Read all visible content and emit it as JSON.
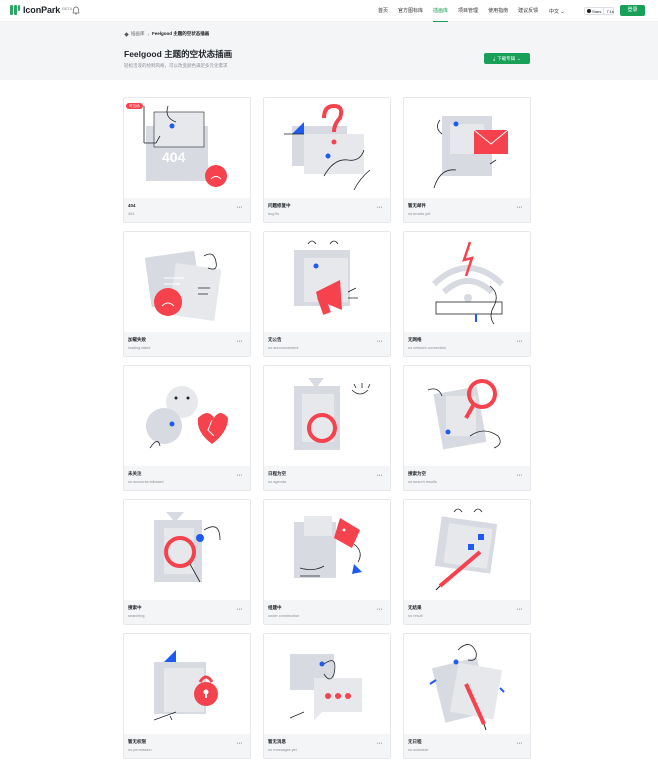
{
  "nav": {
    "logo_text": "IconPark",
    "logo_beta": "BETA",
    "menu": [
      "首页",
      "官方图标库",
      "插画库",
      "项目管理",
      "使用指南",
      "建议反馈"
    ],
    "active_index": 2,
    "lang": "中文",
    "github_label": "Stars",
    "github_count": "7.1k",
    "login": "登录",
    "accent": "#18a058"
  },
  "hero": {
    "breadcrumb_home": "插画库",
    "breadcrumb_current": "Feelgood 主题的空状态插画",
    "title": "Feelgood 主题的空状态插画",
    "subtitle": "轻松活泼的绘制风格，可以改变颜色满足多元化需求",
    "download_label": "下载专辑"
  },
  "cards": [
    {
      "title": "404",
      "subtitle": "404",
      "badge": "可互动",
      "icon": "404-icon"
    },
    {
      "title": "问题修复中",
      "subtitle": "bug fix",
      "icon": "bug-fix-icon"
    },
    {
      "title": "暂无邮件",
      "subtitle": "no emails yet",
      "icon": "no-emails-icon"
    },
    {
      "title": "加载失败",
      "subtitle": "loading failed",
      "icon": "loading-failed-icon"
    },
    {
      "title": "无公告",
      "subtitle": "no announcement",
      "icon": "no-announcement-icon"
    },
    {
      "title": "无网络",
      "subtitle": "no network connection",
      "icon": "no-network-icon"
    },
    {
      "title": "未关注",
      "subtitle": "no accounts followed",
      "icon": "no-follow-icon"
    },
    {
      "title": "日程为空",
      "subtitle": "no agenda",
      "icon": "no-agenda-icon"
    },
    {
      "title": "搜索为空",
      "subtitle": "no search results",
      "icon": "no-search-results-icon"
    },
    {
      "title": "搜索中",
      "subtitle": "searching",
      "icon": "searching-icon"
    },
    {
      "title": "组建中",
      "subtitle": "under construction",
      "icon": "under-construction-icon"
    },
    {
      "title": "无结果",
      "subtitle": "no result",
      "icon": "no-result-icon"
    },
    {
      "title": "暂无权限",
      "subtitle": "no permission",
      "icon": "no-permission-icon"
    },
    {
      "title": "暂无消息",
      "subtitle": "no messages yet",
      "icon": "no-messages-icon"
    },
    {
      "title": "无日程",
      "subtitle": "no schedule",
      "icon": "no-schedule-icon"
    }
  ],
  "more_label": "···",
  "colors": {
    "red": "#f5424d",
    "blue": "#1e5bf0",
    "gray": "#d7dae0",
    "ink": "#1f2329"
  }
}
